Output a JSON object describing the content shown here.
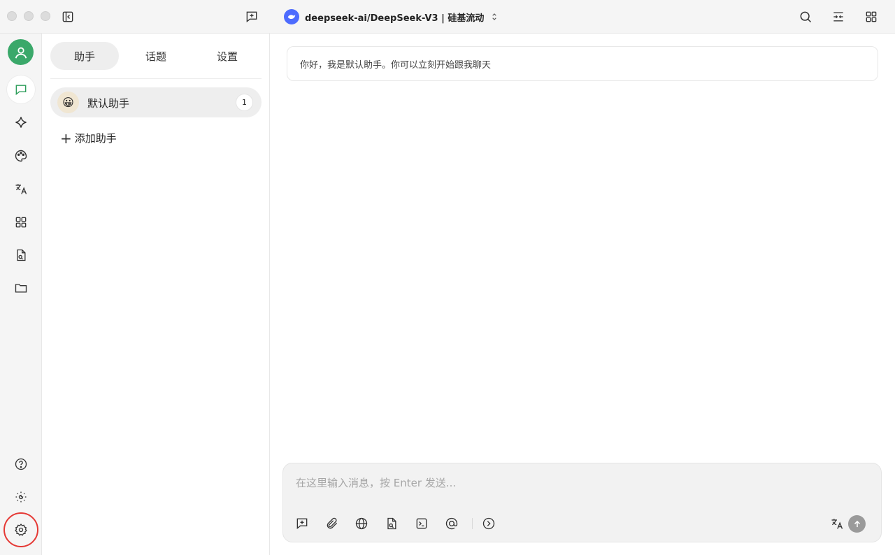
{
  "titlebar": {
    "model_name": "deepseek-ai/DeepSeek-V3 | 硅基流动",
    "brand_color": "#4d6bfe"
  },
  "rail": {
    "items": [
      "chat-icon",
      "sparkle-icon",
      "palette-icon",
      "translate-icon",
      "apps-icon",
      "document-search-icon",
      "folder-icon"
    ],
    "bottom_items": [
      "help-icon",
      "theme-icon",
      "settings-icon"
    ],
    "accent_color": "#2e9e5b"
  },
  "panel": {
    "tabs": [
      {
        "label": "助手"
      },
      {
        "label": "话题"
      },
      {
        "label": "设置"
      }
    ],
    "assistant": {
      "emoji": "😀",
      "name": "默认助手",
      "count": "1"
    },
    "add_label": "添加助手"
  },
  "chat": {
    "greeting": "你好，我是默认助手。你可以立刻开始跟我聊天",
    "input_placeholder": "在这里输入消息，按 Enter 发送..."
  },
  "annotation": {
    "highlight_color": "#e53935"
  }
}
